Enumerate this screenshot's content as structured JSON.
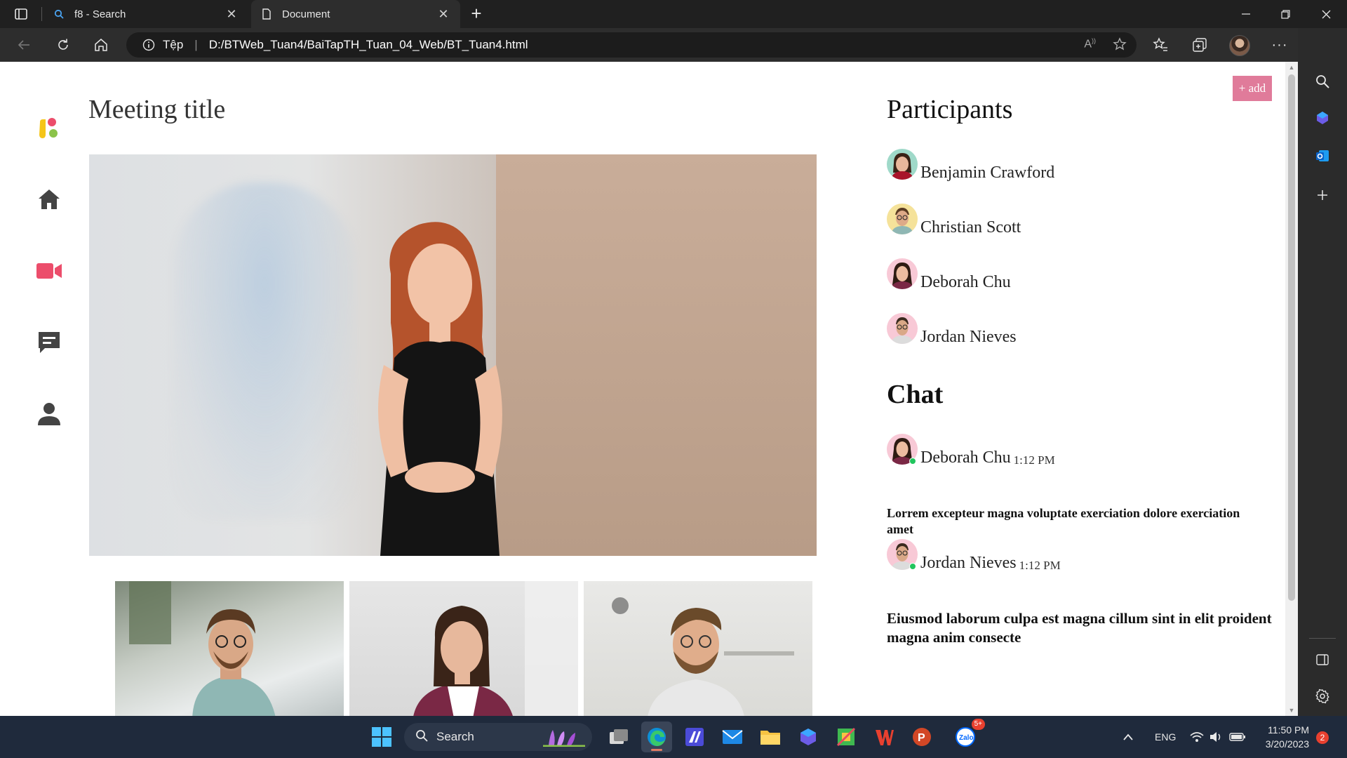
{
  "browser": {
    "tabs": [
      {
        "title": "f8 - Search",
        "active": false
      },
      {
        "title": "Document",
        "active": true
      }
    ],
    "address": {
      "label": "Tệp",
      "separator": "|",
      "url": "D:/BTWeb_Tuan4/BaiTapTH_Tuan_04_Web/BT_Tuan4.html"
    }
  },
  "page": {
    "meeting_title": "Meeting title",
    "add_button": "+ add",
    "participants_title": "Participants",
    "participants": [
      {
        "name": "Benjamin Crawford"
      },
      {
        "name": "Christian Scott"
      },
      {
        "name": "Deborah Chu"
      },
      {
        "name": "Jordan Nieves"
      }
    ],
    "chat_title": "Chat",
    "chat": [
      {
        "name": "Deborah Chu",
        "time": "1:12 PM",
        "message": "Lorrem excepteur magna voluptate exerciation dolore exerciation amet"
      },
      {
        "name": "Jordan Nieves",
        "time": "1:12 PM",
        "message": "Eiusmod laborum culpa est magna cillum sint in elit proident magna anim consecte"
      }
    ],
    "nav_icons": [
      "logo-icon",
      "home-icon",
      "video-camera-icon",
      "chat-icon",
      "user-icon"
    ],
    "accent_color": "#ec4d6b"
  },
  "taskbar": {
    "search_label": "Search",
    "zalo_badge": "5+",
    "language": "ENG",
    "time": "11:50 PM",
    "date": "3/20/2023",
    "notifications": "2"
  }
}
